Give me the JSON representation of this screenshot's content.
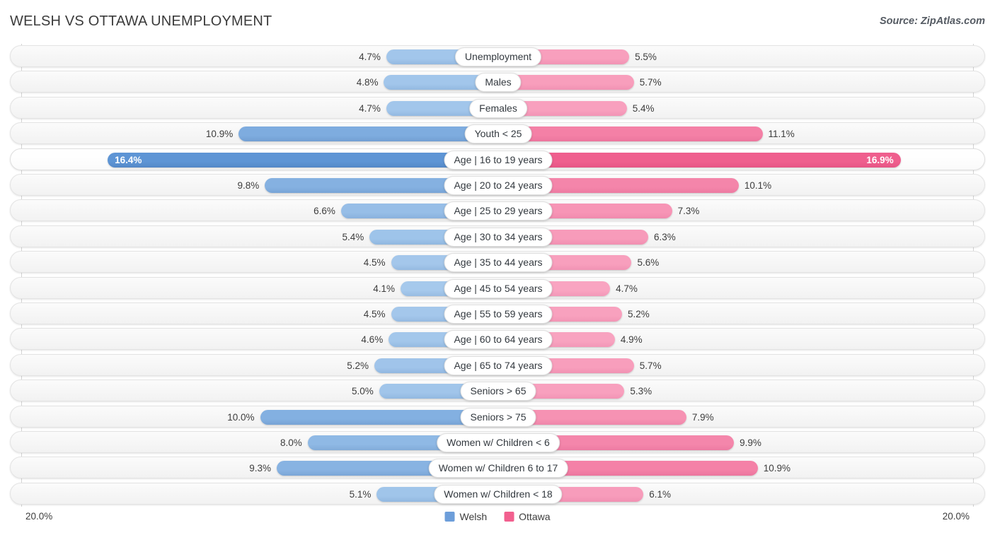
{
  "header": {
    "title": "WELSH VS OTTAWA UNEMPLOYMENT",
    "source": "Source: ZipAtlas.com"
  },
  "axis": {
    "left_label": "20.0%",
    "right_label": "20.0%",
    "max": 20.0
  },
  "legend": {
    "items": [
      {
        "label": "Welsh",
        "color": "#6d9eda"
      },
      {
        "label": "Ottawa",
        "color": "#f2608f"
      }
    ]
  },
  "colors": {
    "welsh_light": "#a6c9ec",
    "welsh_dark": "#5b93d4",
    "ottawa_light": "#f9a7c3",
    "ottawa_dark": "#ef5f8e",
    "track": "#f5f5f5",
    "gridline": "#d4d4d4"
  },
  "chart_data": {
    "type": "bar",
    "orientation": "diverging-horizontal",
    "title": "WELSH VS OTTAWA UNEMPLOYMENT",
    "subtitle": "",
    "xlabel": "",
    "ylabel": "",
    "xlim": [
      20.0,
      20.0
    ],
    "grid": true,
    "legend_position": "bottom-center",
    "categories": [
      "Unemployment",
      "Males",
      "Females",
      "Youth < 25",
      "Age | 16 to 19 years",
      "Age | 20 to 24 years",
      "Age | 25 to 29 years",
      "Age | 30 to 34 years",
      "Age | 35 to 44 years",
      "Age | 45 to 54 years",
      "Age | 55 to 59 years",
      "Age | 60 to 64 years",
      "Age | 65 to 74 years",
      "Seniors > 65",
      "Seniors > 75",
      "Women w/ Children < 6",
      "Women w/ Children 6 to 17",
      "Women w/ Children < 18"
    ],
    "series": [
      {
        "name": "Welsh",
        "color": "#6d9eda",
        "values": [
          4.7,
          4.8,
          4.7,
          10.9,
          16.4,
          9.8,
          6.6,
          5.4,
          4.5,
          4.1,
          4.5,
          4.6,
          5.2,
          5.0,
          10.0,
          8.0,
          9.3,
          5.1
        ],
        "labels": [
          "4.7%",
          "4.8%",
          "4.7%",
          "10.9%",
          "16.4%",
          "9.8%",
          "6.6%",
          "5.4%",
          "4.5%",
          "4.1%",
          "4.5%",
          "4.6%",
          "5.2%",
          "5.0%",
          "10.0%",
          "8.0%",
          "9.3%",
          "5.1%"
        ]
      },
      {
        "name": "Ottawa",
        "color": "#f2608f",
        "values": [
          5.5,
          5.7,
          5.4,
          11.1,
          16.9,
          10.1,
          7.3,
          6.3,
          5.6,
          4.7,
          5.2,
          4.9,
          5.7,
          5.3,
          7.9,
          9.9,
          10.9,
          6.1
        ],
        "labels": [
          "5.5%",
          "5.7%",
          "5.4%",
          "11.1%",
          "16.9%",
          "10.1%",
          "7.3%",
          "6.3%",
          "5.6%",
          "4.7%",
          "5.2%",
          "4.9%",
          "5.7%",
          "5.3%",
          "7.9%",
          "9.9%",
          "10.9%",
          "6.1%"
        ]
      }
    ],
    "highlighted_row": "Age | 16 to 19 years"
  }
}
